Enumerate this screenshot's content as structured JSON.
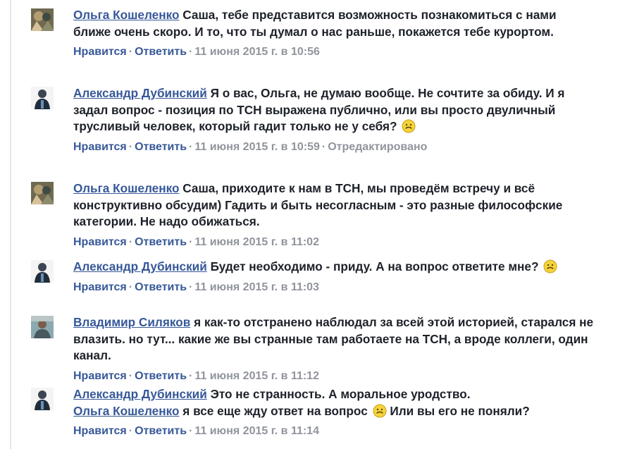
{
  "actions": {
    "like": "Нравится",
    "reply": "Ответить",
    "separator": "·"
  },
  "comments": [
    {
      "author": "Ольга Кошеленко",
      "avatar": "olga-avatar",
      "text": "Саша, тебе представится возможность познакомиться с нами ближе очень скоро. И то, что ты думал о нас раньше, покажется тебе курортом.",
      "timestamp": "11 июня 2015 г. в 10:56",
      "edited": ""
    },
    {
      "author": "Александр Дубинский",
      "avatar": "alexander-avatar",
      "text": "Я о вас, Ольга, не думаю вообще. Не сочтите за обиду. И я задал вопрос - позиция по ТСН выражена публично, или вы просто двуличный трусливый человек, который гадит только не у себя?",
      "emoji": "confused-face-emoji",
      "timestamp": "11 июня 2015 г. в 10:59",
      "edited": "Отредактировано"
    },
    {
      "author": "Ольга Кошеленко",
      "avatar": "olga-avatar",
      "text": "Саша, приходите к нам в ТСН, мы проведём встречу и всё конструктивно обсудим) Гадить и быть несогласным - это разные философские категории. Не надо обижаться.",
      "timestamp": "11 июня 2015 г. в 11:02",
      "edited": ""
    },
    {
      "author": "Александр Дубинский",
      "avatar": "alexander-avatar",
      "text": "Будет необходимо - приду. А на вопрос ответите мне?",
      "emoji": "confused-face-emoji",
      "timestamp": "11 июня 2015 г. в 11:03",
      "edited": ""
    },
    {
      "author": "Владимир Силяков",
      "avatar": "vladimir-avatar",
      "text": "я как-то отстранено наблюдал за всей этой историей, старался не влазить. но тут... какие же вы странные там работаете на ТСН, а вроде коллеги, один канал.",
      "timestamp": "11 июня 2015 г. в 11:12",
      "edited": ""
    },
    {
      "author": "Александр Дубинский",
      "avatar": "alexander-avatar",
      "text": "Это не странность. А моральное уродство.",
      "mention": "Ольга Кошеленко",
      "text_after_mention": "я все еще жду ответ на вопрос",
      "emoji": "confused-face-emoji",
      "text_after_emoji": "Или вы его не поняли?",
      "timestamp": "11 июня 2015 г. в 11:14",
      "edited": ""
    }
  ]
}
